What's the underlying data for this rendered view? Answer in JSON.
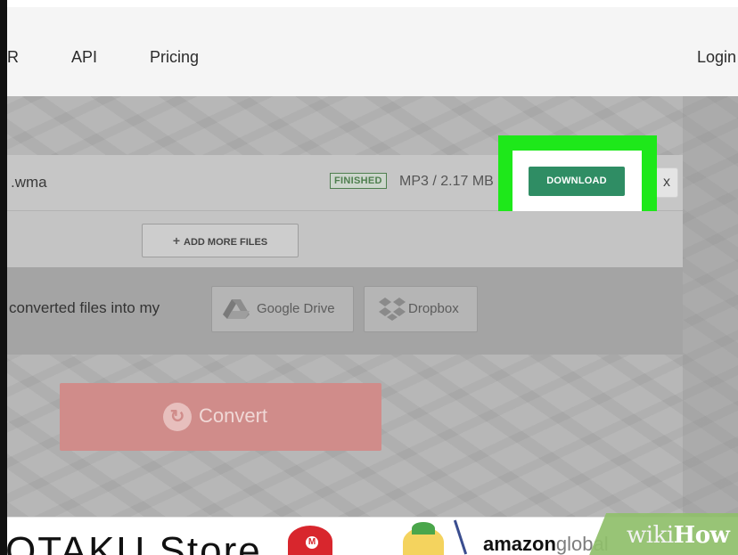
{
  "nav": {
    "items": [
      "R",
      "API",
      "Pricing"
    ],
    "login": "Login"
  },
  "file": {
    "name": ".wma",
    "status": "FINISHED",
    "info": "MP3 / 2.17 MB",
    "download_label": "DOWNLOAD",
    "close_label": "x"
  },
  "add_more": {
    "icon": "+",
    "label": "ADD MORE FILES"
  },
  "save": {
    "label": "converted files into my",
    "google_drive": "Google Drive",
    "dropbox": "Dropbox"
  },
  "convert": {
    "label": "Convert",
    "icon": "refresh-icon"
  },
  "bottom": {
    "store_text": "OTAKU Store",
    "amazon_text": "amazon",
    "amazon_suffix": "global"
  },
  "watermark": {
    "wiki": "wiki",
    "how": "How"
  },
  "colors": {
    "highlight": "#1ee81a",
    "download_button": "#2f8d64",
    "convert_button": "#d08c8a"
  }
}
